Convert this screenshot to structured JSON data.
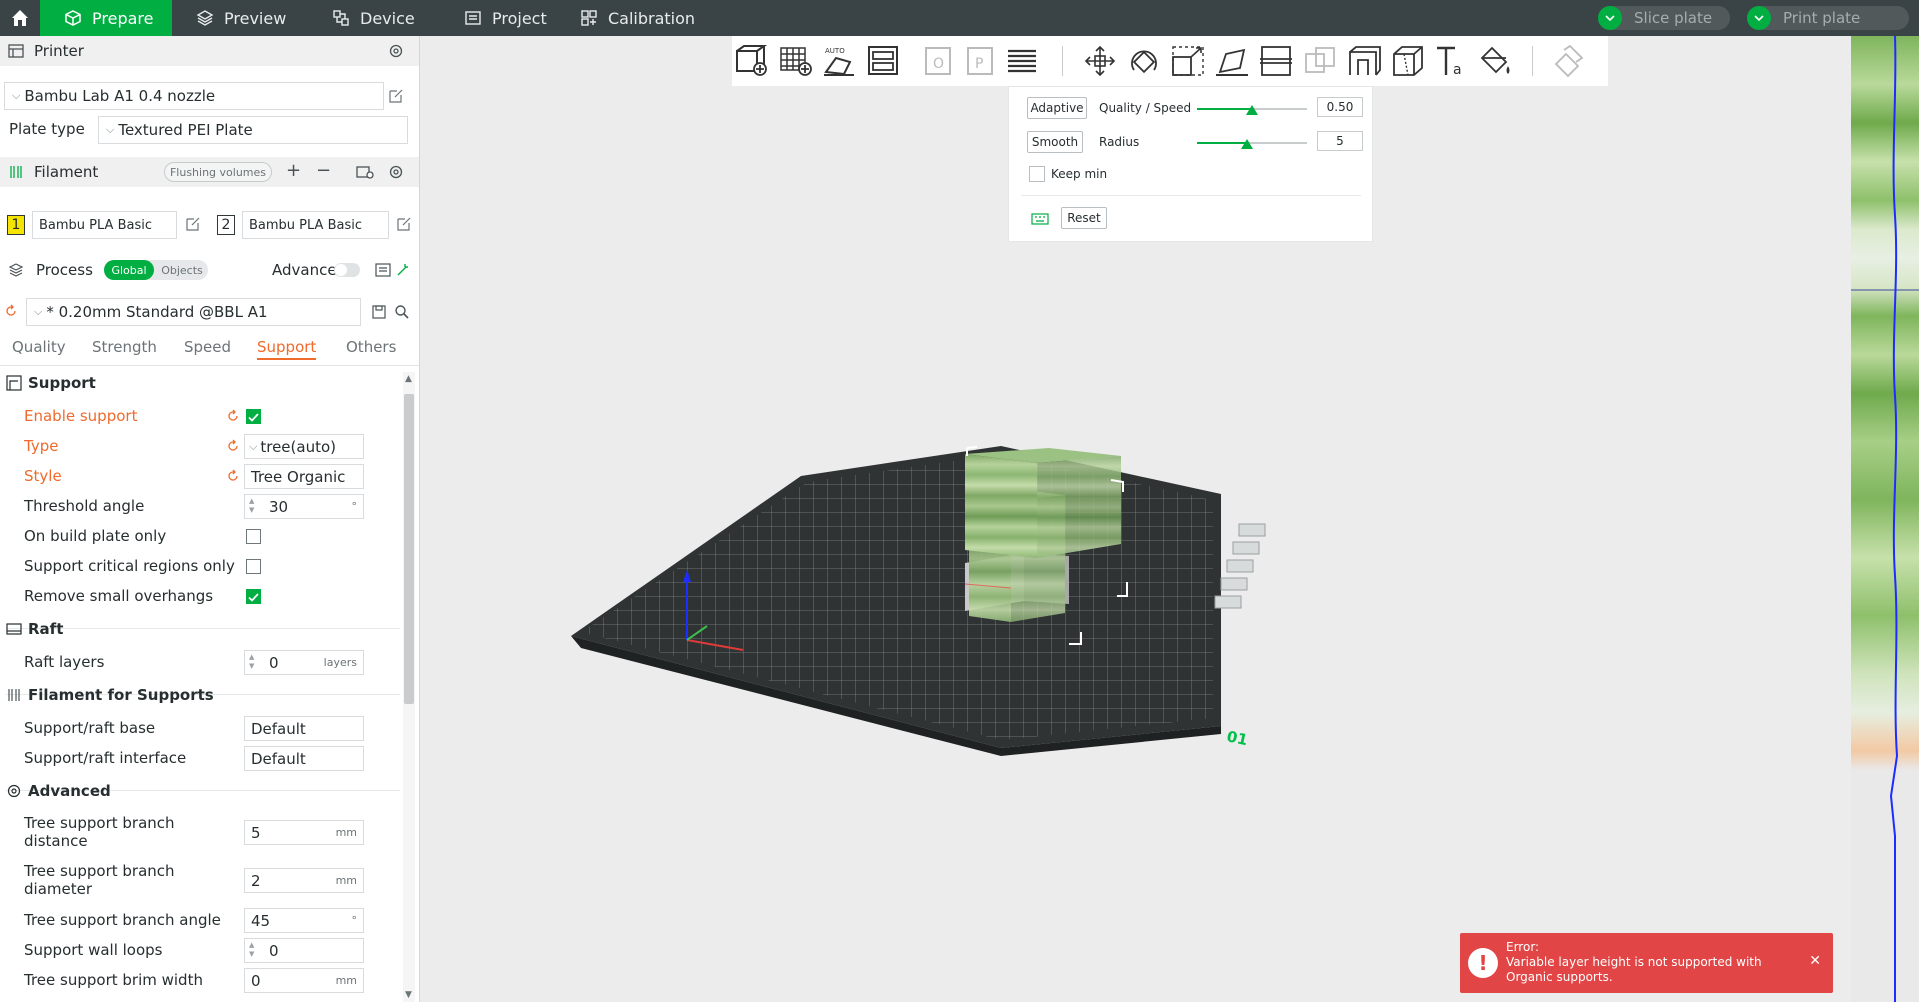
{
  "topbar": {
    "tabs": [
      {
        "label": "Prepare",
        "active": true
      },
      {
        "label": "Preview"
      },
      {
        "label": "Device"
      },
      {
        "label": "Project"
      },
      {
        "label": "Calibration"
      }
    ],
    "slice_label": "Slice plate",
    "print_label": "Print plate"
  },
  "printer": {
    "section_title": "Printer",
    "name": "Bambu Lab A1 0.4 nozzle",
    "plate_type_label": "Plate type",
    "plate_type": "Textured PEI Plate"
  },
  "filament": {
    "section_title": "Filament",
    "flushing_label": "Flushing volumes",
    "items": [
      {
        "num": "1",
        "name": "Bambu PLA Basic",
        "color": "#f5e400"
      },
      {
        "num": "2",
        "name": "Bambu PLA Basic",
        "color": "#ffffff"
      }
    ]
  },
  "process": {
    "section_title": "Process",
    "toggle_global": "Global",
    "toggle_objects": "Objects",
    "advance_label": "Advance",
    "preset": "* 0.20mm Standard @BBL A1",
    "tabs": [
      "Quality",
      "Strength",
      "Speed",
      "Support",
      "Others"
    ],
    "active_tab": "Support"
  },
  "support": {
    "group_title": "Support",
    "enable_label": "Enable support",
    "enable_checked": true,
    "type_label": "Type",
    "type_value": "tree(auto)",
    "style_label": "Style",
    "style_value": "Tree Organic",
    "threshold_label": "Threshold angle",
    "threshold_value": "30",
    "threshold_unit": "°",
    "build_plate_label": "On build plate only",
    "critical_label": "Support critical regions only",
    "remove_small_label": "Remove small overhangs",
    "remove_small_checked": true
  },
  "raft": {
    "group_title": "Raft",
    "layers_label": "Raft layers",
    "layers_value": "0",
    "layers_unit": "layers"
  },
  "filament_support": {
    "group_title": "Filament for Supports",
    "base_label": "Support/raft base",
    "base_value": "Default",
    "interface_label": "Support/raft interface",
    "interface_value": "Default"
  },
  "advanced": {
    "group_title": "Advanced",
    "branch_distance_label_1": "Tree support branch",
    "branch_distance_label_2": "distance",
    "branch_distance_value": "5",
    "branch_distance_unit": "mm",
    "branch_diameter_label_1": "Tree support branch",
    "branch_diameter_label_2": "diameter",
    "branch_diameter_value": "2",
    "branch_diameter_unit": "mm",
    "branch_angle_label": "Tree support branch angle",
    "branch_angle_value": "45",
    "branch_angle_unit": "°",
    "wall_loops_label": "Support wall loops",
    "wall_loops_value": "0",
    "brim_label": "Tree support brim width",
    "brim_value": "0",
    "brim_unit": "mm"
  },
  "vlh": {
    "adaptive_label": "Adaptive",
    "quality_speed_label": "Quality / Speed",
    "quality_speed_value": "0.50",
    "quality_speed_fraction": 0.5,
    "smooth_label": "Smooth",
    "radius_label": "Radius",
    "radius_value": "5",
    "radius_fraction": 0.45,
    "keep_min_label": "Keep min",
    "reset_label": "Reset"
  },
  "plate": {
    "number_label": "01"
  },
  "error": {
    "title": "Error:",
    "message": "Variable layer height is not supported with Organic supports."
  },
  "colors": {
    "accent": "#00ae42",
    "modified": "#ef6a2c",
    "error": "#e14545"
  }
}
